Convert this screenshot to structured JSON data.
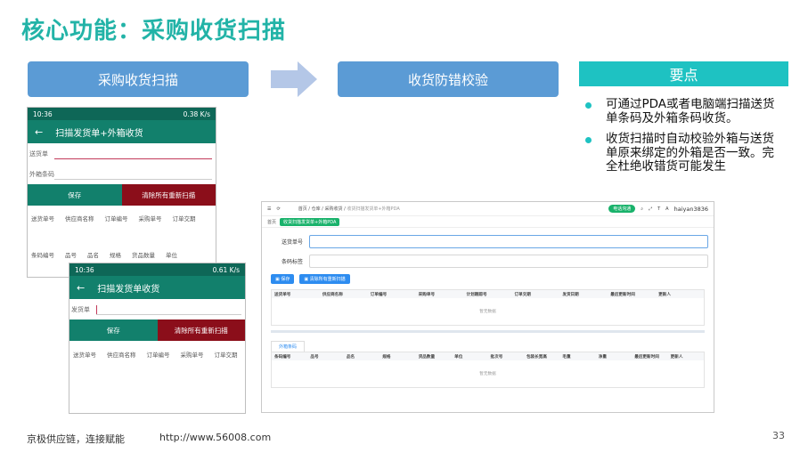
{
  "slide": {
    "title": "核心功能：采购收货扫描",
    "flow_step_1": "采购收货扫描",
    "flow_step_2": "收货防错校验",
    "key_header": "要点",
    "key_points": [
      "可通过PDA或者电脑端扫描送货单条码及外箱条码收货。",
      "收货扫描时自动校验外箱与送货单原来绑定的外箱是否一致。完全杜绝收错货可能发生"
    ],
    "footer_brand": "京极供应链，连接赋能",
    "footer_url": "http://www.56008.com",
    "page_number": "33"
  },
  "phone1": {
    "time": "10:36",
    "status_right": "0.38 K/s",
    "title": "扫描发货单+外箱收货",
    "field1_label": "送货单",
    "field2_label": "外箱条码",
    "save_label": "保存",
    "clear_label": "清除所有重新扫描",
    "cols_a": [
      "送货单号",
      "供应商名称",
      "订单编号",
      "采购单号",
      "订单交期"
    ],
    "cols_b": [
      "条码编号",
      "品号",
      "品名",
      "规格",
      "货品数量",
      "单位"
    ]
  },
  "phone2": {
    "time": "10:36",
    "status_right": "0.61 K/s",
    "title": "扫描发货单收货",
    "field1_label": "发货单",
    "save_label": "保存",
    "clear_label": "清除所有重新扫描",
    "cols": [
      "送货单号",
      "供应商名称",
      "订单编号",
      "采购单号",
      "订单交期"
    ]
  },
  "desktop": {
    "breadcrumb": [
      "首页",
      "仓库",
      "采购收货"
    ],
    "breadcrumb_current": "收货扫描发货单+外箱PDA",
    "green_pill": "电话沟通",
    "user": "haiyan3836",
    "tab_home": "首页",
    "tab_active": "收货扫描发货单+外箱PDA",
    "field1_label": "送货单号",
    "field2_label": "条码标签",
    "save_btn": "保存",
    "clear_btn": "清除所有重新扫描",
    "table1_cols": [
      "送货单号",
      "供应商名称",
      "订单编号",
      "采购单号",
      "计划跟踪号",
      "订单交期",
      "发货日期",
      "最后更新时间",
      "更新人"
    ],
    "empty_text": "暂无数据",
    "subtab": "外箱条码",
    "table2_cols": [
      "条码编号",
      "品号",
      "品名",
      "规格",
      "货品数量",
      "单位",
      "批次号",
      "包装长宽高",
      "毛重",
      "净重",
      "最后更新时间",
      "更新人"
    ],
    "empty_text2": "暂无数据"
  },
  "colors": {
    "title": "#22b3a7",
    "flow_box": "#5b9bd5",
    "key_header": "#1ec2c2",
    "app_green": "#12806c",
    "clear_red": "#8b0e1a",
    "action_blue": "#2d8cf0"
  }
}
